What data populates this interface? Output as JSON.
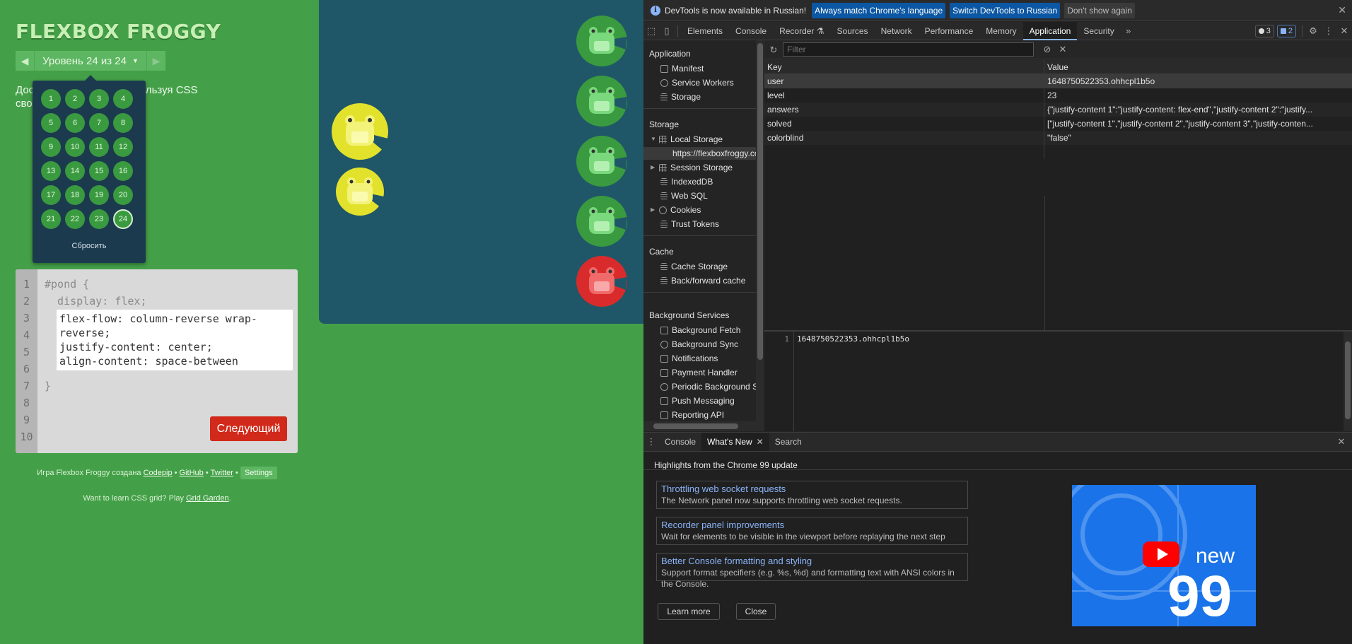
{
  "game": {
    "logo": "FLEXBOX FROGGY",
    "level_label": "Уровень 24 из 24",
    "instructions": [
      "Дос    з последний раз, используя CSS",
      "сво                  ил:"
    ],
    "level_menu": {
      "levels": [
        "1",
        "2",
        "3",
        "4",
        "5",
        "6",
        "7",
        "8",
        "9",
        "10",
        "11",
        "12",
        "13",
        "14",
        "15",
        "16",
        "17",
        "18",
        "19",
        "20",
        "21",
        "22",
        "23",
        "24"
      ],
      "current": "24",
      "reset_label": "Сбросить"
    },
    "editor": {
      "line_numbers": [
        "1",
        "2",
        "3",
        "4",
        "5",
        "6",
        "7",
        "8",
        "9",
        "10"
      ],
      "line1": "#pond {",
      "line2": "  display: flex;",
      "answer_lines": [
        "flex-flow: column-reverse wrap-reverse;",
        "justify-content: center;",
        "align-content: space-between"
      ],
      "closing": "}",
      "next_label": "Следующий"
    },
    "credits": {
      "prefix": "Игра Flexbox Froggy создана",
      "codepip": "Codepip",
      "github": "GitHub",
      "twitter": "Twitter",
      "settings": "Settings",
      "grid_prefix": "Want to learn CSS grid? Play",
      "grid_link": "Grid Garden",
      "grid_suffix": "."
    }
  },
  "devtools": {
    "infobar": {
      "text": "DevTools is now available in Russian!",
      "btn_match": "Always match Chrome's language",
      "btn_switch": "Switch DevTools to Russian",
      "btn_dismiss": "Don't show again"
    },
    "tabs": [
      "Elements",
      "Console",
      "Recorder",
      "Sources",
      "Network",
      "Performance",
      "Memory",
      "Application",
      "Security"
    ],
    "active_tab": "Application",
    "badges": {
      "issues": "3",
      "messages": "2"
    },
    "sidebar": {
      "application_title": "Application",
      "application_items": [
        "Manifest",
        "Service Workers",
        "Storage"
      ],
      "storage_title": "Storage",
      "storage_items": [
        "Local Storage",
        "https://flexboxfroggy.co",
        "Session Storage",
        "IndexedDB",
        "Web SQL",
        "Cookies",
        "Trust Tokens"
      ],
      "cache_title": "Cache",
      "cache_items": [
        "Cache Storage",
        "Back/forward cache"
      ],
      "bg_title": "Background Services",
      "bg_items": [
        "Background Fetch",
        "Background Sync",
        "Notifications",
        "Payment Handler",
        "Periodic Background Sync",
        "Push Messaging",
        "Reporting API"
      ]
    },
    "storage": {
      "filter_placeholder": "Filter",
      "col_key": "Key",
      "col_value": "Value",
      "rows": [
        {
          "key": "user",
          "value": "1648750522353.ohhcpl1b5o"
        },
        {
          "key": "level",
          "value": "23"
        },
        {
          "key": "answers",
          "value": "{\"justify-content 1\":\"justify-content: flex-end\",\"justify-content 2\":\"justify..."
        },
        {
          "key": "solved",
          "value": "[\"justify-content 1\",\"justify-content 2\",\"justify-content 3\",\"justify-conten..."
        },
        {
          "key": "colorblind",
          "value": "\"false\""
        }
      ],
      "preview_line": "1",
      "preview_value": "1648750522353.ohhcpl1b5o"
    },
    "drawer": {
      "tabs": [
        "Console",
        "What's New",
        "Search"
      ],
      "active": "What's New",
      "highlights_title": "Highlights from the Chrome 99 update",
      "cards": [
        {
          "title": "Throttling web socket requests",
          "desc": "The Network panel now supports throttling web socket requests."
        },
        {
          "title": "Recorder panel improvements",
          "desc": "Wait for elements to be visible in the viewport before replaying the next step"
        },
        {
          "title": "Better Console formatting and styling",
          "desc": "Support format specifiers (e.g. %s, %d) and formatting text with ANSI colors in the Console."
        }
      ],
      "learn_more": "Learn more",
      "close": "Close",
      "image_word": "new",
      "image_number": "99"
    }
  },
  "colors": {
    "game_bg": "#44a048",
    "pond": "#1f5768",
    "devtools_bg": "#242424",
    "accent_blue": "#8ab4f8",
    "next_button": "#d12a1a"
  }
}
